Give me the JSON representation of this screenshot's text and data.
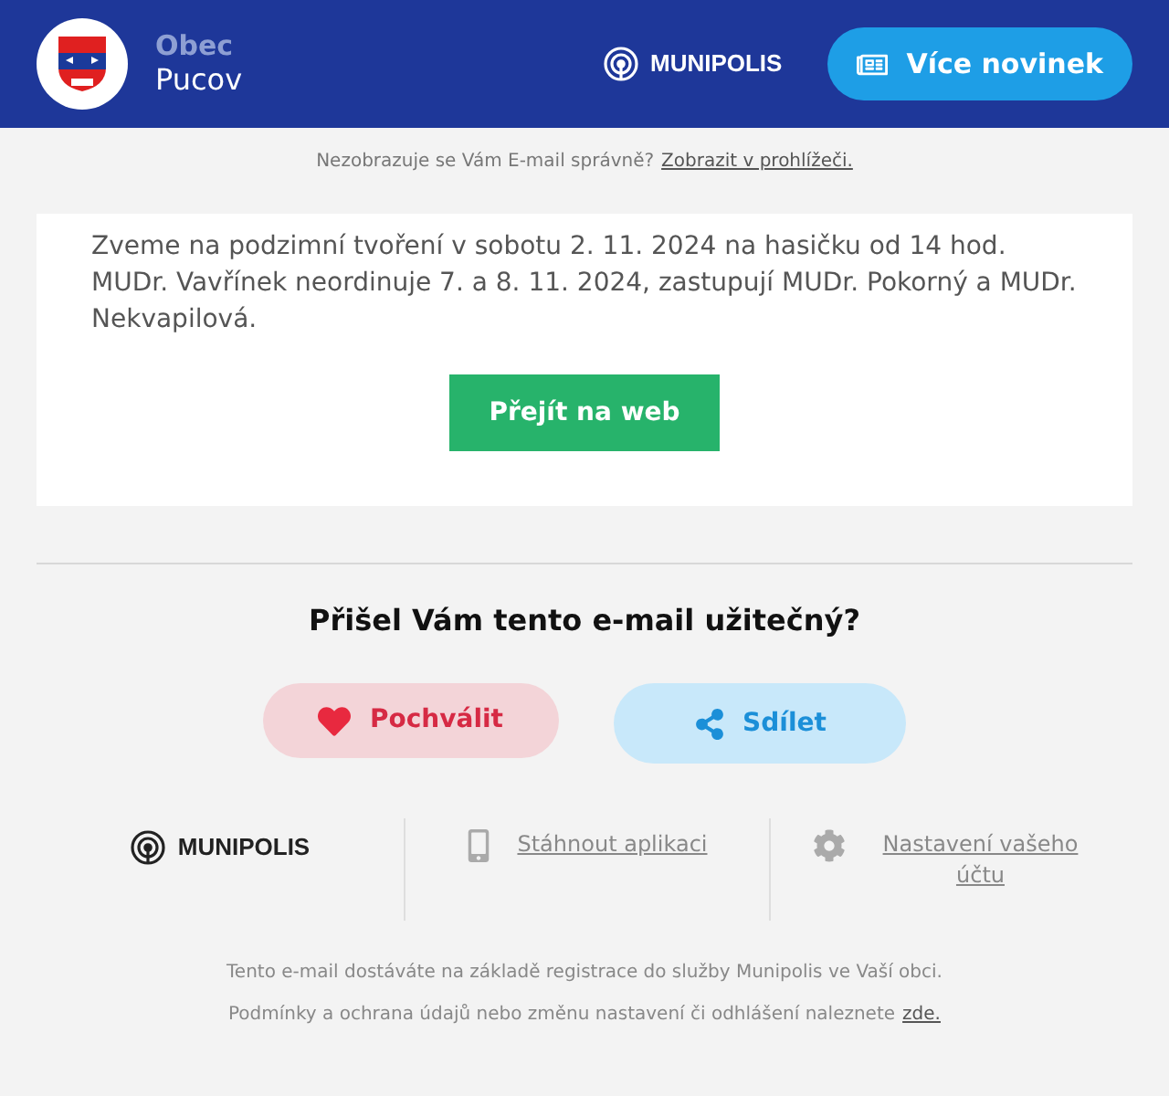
{
  "header": {
    "municipality_label": "Obec",
    "municipality_name": "Pucov",
    "brand": "MUNIPOLIS",
    "news_button": "Více novinek"
  },
  "notice": {
    "text": "Nezobrazuje se Vám E-mail správně?",
    "link": "Zobrazit v prohlížeči."
  },
  "content": {
    "paragraphs": [
      "Zveme na podzimní tvoření v sobotu 2. 11. 2024 na hasičku od 14 hod.",
      "MUDr. Vavřínek neordinuje 7. a 8. 11. 2024, zastupují MUDr. Pokorný a MUDr. Nekvapilová."
    ],
    "button": "Přejít na web"
  },
  "feedback": {
    "question": "Přišel Vám tento e-mail užitečný?",
    "buttons": [
      {
        "kind": "praise",
        "label": "Pochválit"
      },
      {
        "kind": "share",
        "label": "Sdílet"
      }
    ]
  },
  "footer": {
    "brand": "MUNIPOLIS",
    "links": [
      {
        "kind": "app",
        "label": "Stáhnout aplikaci"
      },
      {
        "kind": "settings",
        "label": "Nastavení vašeho účtu"
      }
    ],
    "info": "Tento e-mail dostáváte na základě registrace do služby Munipolis ve Vaší obci.",
    "terms": "Podmínky a ochrana údajů nebo změnu nastavení či odhlášení naleznete",
    "terms_link": "zde."
  }
}
